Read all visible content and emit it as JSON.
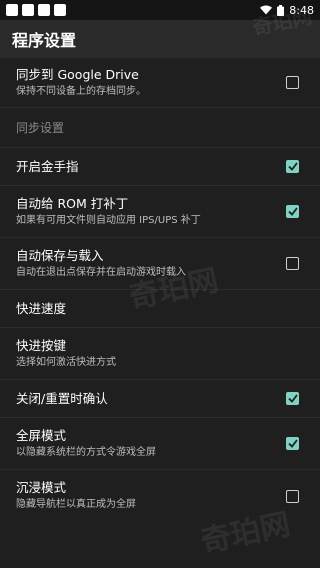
{
  "status_bar": {
    "time": "8:48"
  },
  "app_bar": {
    "title": "程序设置"
  },
  "settings": {
    "google_drive": {
      "title": "同步到 Google Drive",
      "subtitle": "保持不同设备上的存档同步。",
      "checked": false
    },
    "sync_header": "同步设置",
    "golden_finger": {
      "title": "开启金手指",
      "checked": true
    },
    "auto_patch": {
      "title": "自动给 ROM 打补丁",
      "subtitle": "如果有可用文件则自动应用 IPS/UPS 补丁",
      "checked": true
    },
    "auto_save": {
      "title": "自动保存与载入",
      "subtitle": "自动在退出点保存并在启动游戏时载入",
      "checked": false
    },
    "fast_speed": {
      "title": "快进速度"
    },
    "fast_key": {
      "title": "快进按键",
      "subtitle": "选择如何激活快进方式"
    },
    "confirm_close": {
      "title": "关闭/重置时确认",
      "checked": true
    },
    "fullscreen": {
      "title": "全屏模式",
      "subtitle": "以隐藏系统栏的方式令游戏全屏",
      "checked": true
    },
    "immersive": {
      "title": "沉浸模式",
      "subtitle": "隐藏导航栏以真正成为全屏",
      "checked": false
    }
  },
  "colors": {
    "accent": "#7fd3c5",
    "background": "#1f1f1f"
  },
  "watermark_text": "奇珀网"
}
